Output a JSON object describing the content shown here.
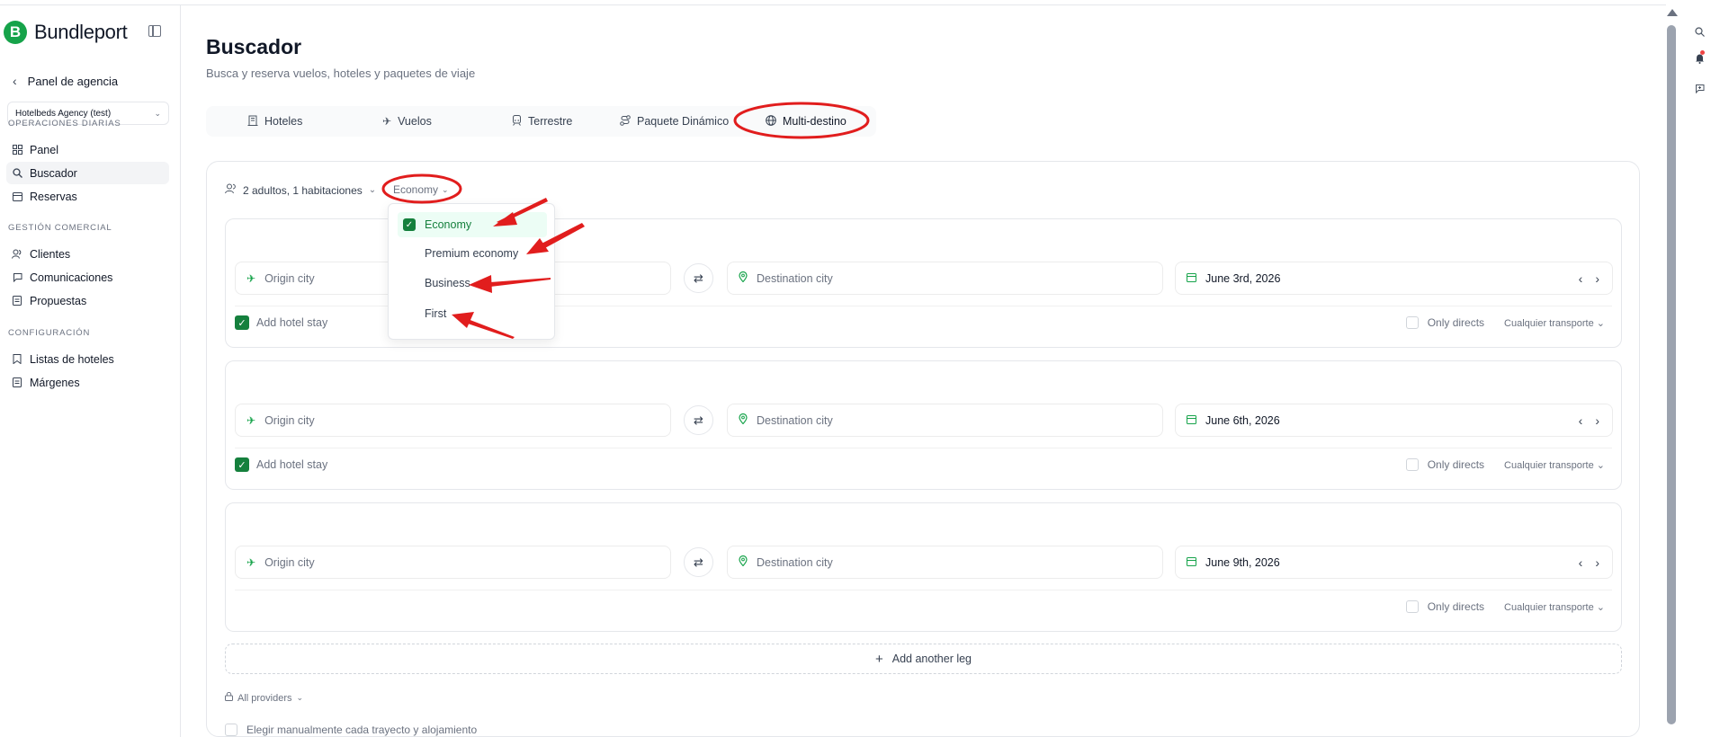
{
  "brand": {
    "name": "Bundleport",
    "logo_letter": "B"
  },
  "sidebar": {
    "back_label": "Panel de agencia",
    "agency": "Hotelbeds Agency (test)",
    "sections": [
      {
        "title": "OPERACIONES DIARIAS",
        "items": [
          {
            "label": "Panel",
            "icon": "grid-icon"
          },
          {
            "label": "Buscador",
            "icon": "search-icon",
            "active": true
          },
          {
            "label": "Reservas",
            "icon": "calendar-icon"
          }
        ]
      },
      {
        "title": "GESTIÓN COMERCIAL",
        "items": [
          {
            "label": "Clientes",
            "icon": "users-icon"
          },
          {
            "label": "Comunicaciones",
            "icon": "message-icon"
          },
          {
            "label": "Propuestas",
            "icon": "document-icon"
          }
        ]
      },
      {
        "title": "CONFIGURACIÓN",
        "items": [
          {
            "label": "Listas de hoteles",
            "icon": "bookmark-icon"
          },
          {
            "label": "Márgenes",
            "icon": "document-icon"
          }
        ]
      }
    ]
  },
  "page": {
    "title": "Buscador",
    "subtitle": "Busca y reserva vuelos, hoteles y paquetes de viaje"
  },
  "tabs": [
    {
      "label": "Hoteles",
      "icon": "building-icon"
    },
    {
      "label": "Vuelos",
      "icon": "plane-icon"
    },
    {
      "label": "Terrestre",
      "icon": "train-icon"
    },
    {
      "label": "Paquete Dinámico",
      "icon": "route-icon"
    },
    {
      "label": "Multi-destino",
      "icon": "globe-icon",
      "active": true
    }
  ],
  "search": {
    "passengers": "2 adultos, 1 habitaciones",
    "cabin": "Economy",
    "cabin_options": [
      {
        "label": "Economy",
        "checked": true
      },
      {
        "label": "Premium economy",
        "checked": false
      },
      {
        "label": "Business",
        "checked": false
      },
      {
        "label": "First",
        "checked": false
      }
    ],
    "origin_placeholder": "Origin city",
    "destination_placeholder": "Destination city",
    "legs": [
      {
        "date": "June 3rd, 2026",
        "hotel_label": "Add hotel stay",
        "hotel_checked": true
      },
      {
        "date": "June 6th, 2026",
        "hotel_label": "Add hotel stay",
        "hotel_checked": true
      },
      {
        "date": "June 9th, 2026",
        "hotel_label": "",
        "hotel_checked": false
      }
    ],
    "only_directs": "Only directs",
    "transport": "Cualquier transporte",
    "add_leg": "Add another leg",
    "providers": "All providers",
    "manual": "Elegir manualmente cada trayecto y alojamiento"
  },
  "colors": {
    "accent": "#16a34a",
    "annotation": "#e11d1d"
  }
}
